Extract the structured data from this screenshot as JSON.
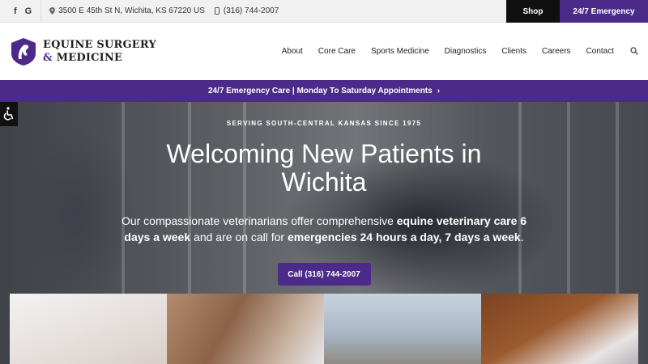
{
  "topbar": {
    "social": [
      "f",
      "G"
    ],
    "address": "3500 E 45th St N, Wichita, KS 67220 US",
    "phone": "(316) 744-2007",
    "shop_label": "Shop",
    "emergency_label": "24/7 Emergency"
  },
  "header": {
    "logo_line1": "EQUINE SURGERY",
    "logo_amp": "&",
    "logo_line2": "MEDICINE",
    "nav": [
      "About",
      "Core Care",
      "Sports Medicine",
      "Diagnostics",
      "Clients",
      "Careers",
      "Contact"
    ]
  },
  "promo": {
    "text": "24/7 Emergency Care | Monday To Saturday Appointments",
    "chevron": "›"
  },
  "hero": {
    "eyebrow": "SERVING SOUTH-CENTRAL KANSAS SINCE 1975",
    "headline": "Welcoming New Patients in Wichita",
    "sub_part1": "Our compassionate veterinarians offer comprehensive ",
    "sub_bold1": "equine veterinary care 6 days a week",
    "sub_part2": " and are on call for ",
    "sub_bold2": "emergencies 24 hours a day, 7 days a week",
    "sub_part3": ".",
    "cta_label": "Call (316) 744-2007"
  },
  "colors": {
    "brand_purple": "#4b2a8a",
    "topbar_bg": "#f1f1f1",
    "shop_bg": "#101010"
  }
}
